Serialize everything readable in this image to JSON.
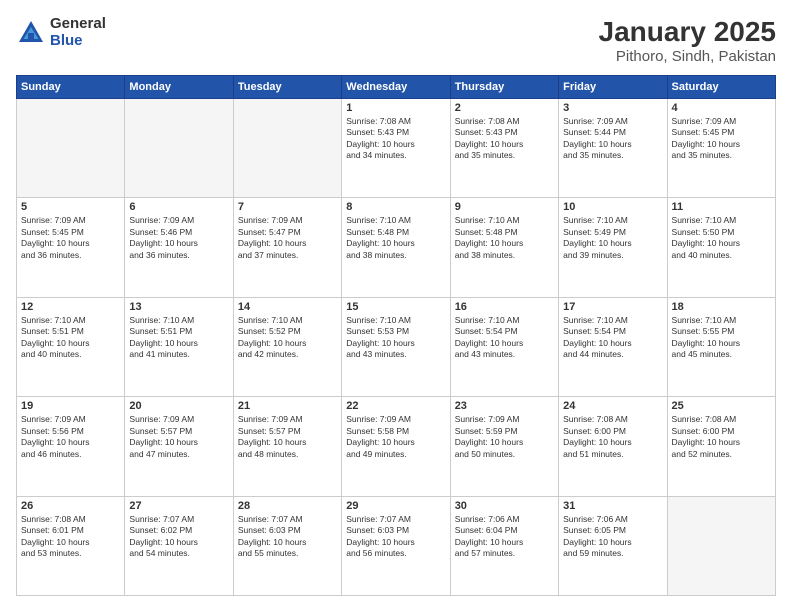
{
  "header": {
    "logo_general": "General",
    "logo_blue": "Blue",
    "title": "January 2025",
    "subtitle": "Pithoro, Sindh, Pakistan"
  },
  "days_of_week": [
    "Sunday",
    "Monday",
    "Tuesday",
    "Wednesday",
    "Thursday",
    "Friday",
    "Saturday"
  ],
  "weeks": [
    [
      {
        "day": "",
        "info": ""
      },
      {
        "day": "",
        "info": ""
      },
      {
        "day": "",
        "info": ""
      },
      {
        "day": "1",
        "info": "Sunrise: 7:08 AM\nSunset: 5:43 PM\nDaylight: 10 hours\nand 34 minutes."
      },
      {
        "day": "2",
        "info": "Sunrise: 7:08 AM\nSunset: 5:43 PM\nDaylight: 10 hours\nand 35 minutes."
      },
      {
        "day": "3",
        "info": "Sunrise: 7:09 AM\nSunset: 5:44 PM\nDaylight: 10 hours\nand 35 minutes."
      },
      {
        "day": "4",
        "info": "Sunrise: 7:09 AM\nSunset: 5:45 PM\nDaylight: 10 hours\nand 35 minutes."
      }
    ],
    [
      {
        "day": "5",
        "info": "Sunrise: 7:09 AM\nSunset: 5:45 PM\nDaylight: 10 hours\nand 36 minutes."
      },
      {
        "day": "6",
        "info": "Sunrise: 7:09 AM\nSunset: 5:46 PM\nDaylight: 10 hours\nand 36 minutes."
      },
      {
        "day": "7",
        "info": "Sunrise: 7:09 AM\nSunset: 5:47 PM\nDaylight: 10 hours\nand 37 minutes."
      },
      {
        "day": "8",
        "info": "Sunrise: 7:10 AM\nSunset: 5:48 PM\nDaylight: 10 hours\nand 38 minutes."
      },
      {
        "day": "9",
        "info": "Sunrise: 7:10 AM\nSunset: 5:48 PM\nDaylight: 10 hours\nand 38 minutes."
      },
      {
        "day": "10",
        "info": "Sunrise: 7:10 AM\nSunset: 5:49 PM\nDaylight: 10 hours\nand 39 minutes."
      },
      {
        "day": "11",
        "info": "Sunrise: 7:10 AM\nSunset: 5:50 PM\nDaylight: 10 hours\nand 40 minutes."
      }
    ],
    [
      {
        "day": "12",
        "info": "Sunrise: 7:10 AM\nSunset: 5:51 PM\nDaylight: 10 hours\nand 40 minutes."
      },
      {
        "day": "13",
        "info": "Sunrise: 7:10 AM\nSunset: 5:51 PM\nDaylight: 10 hours\nand 41 minutes."
      },
      {
        "day": "14",
        "info": "Sunrise: 7:10 AM\nSunset: 5:52 PM\nDaylight: 10 hours\nand 42 minutes."
      },
      {
        "day": "15",
        "info": "Sunrise: 7:10 AM\nSunset: 5:53 PM\nDaylight: 10 hours\nand 43 minutes."
      },
      {
        "day": "16",
        "info": "Sunrise: 7:10 AM\nSunset: 5:54 PM\nDaylight: 10 hours\nand 43 minutes."
      },
      {
        "day": "17",
        "info": "Sunrise: 7:10 AM\nSunset: 5:54 PM\nDaylight: 10 hours\nand 44 minutes."
      },
      {
        "day": "18",
        "info": "Sunrise: 7:10 AM\nSunset: 5:55 PM\nDaylight: 10 hours\nand 45 minutes."
      }
    ],
    [
      {
        "day": "19",
        "info": "Sunrise: 7:09 AM\nSunset: 5:56 PM\nDaylight: 10 hours\nand 46 minutes."
      },
      {
        "day": "20",
        "info": "Sunrise: 7:09 AM\nSunset: 5:57 PM\nDaylight: 10 hours\nand 47 minutes."
      },
      {
        "day": "21",
        "info": "Sunrise: 7:09 AM\nSunset: 5:57 PM\nDaylight: 10 hours\nand 48 minutes."
      },
      {
        "day": "22",
        "info": "Sunrise: 7:09 AM\nSunset: 5:58 PM\nDaylight: 10 hours\nand 49 minutes."
      },
      {
        "day": "23",
        "info": "Sunrise: 7:09 AM\nSunset: 5:59 PM\nDaylight: 10 hours\nand 50 minutes."
      },
      {
        "day": "24",
        "info": "Sunrise: 7:08 AM\nSunset: 6:00 PM\nDaylight: 10 hours\nand 51 minutes."
      },
      {
        "day": "25",
        "info": "Sunrise: 7:08 AM\nSunset: 6:00 PM\nDaylight: 10 hours\nand 52 minutes."
      }
    ],
    [
      {
        "day": "26",
        "info": "Sunrise: 7:08 AM\nSunset: 6:01 PM\nDaylight: 10 hours\nand 53 minutes."
      },
      {
        "day": "27",
        "info": "Sunrise: 7:07 AM\nSunset: 6:02 PM\nDaylight: 10 hours\nand 54 minutes."
      },
      {
        "day": "28",
        "info": "Sunrise: 7:07 AM\nSunset: 6:03 PM\nDaylight: 10 hours\nand 55 minutes."
      },
      {
        "day": "29",
        "info": "Sunrise: 7:07 AM\nSunset: 6:03 PM\nDaylight: 10 hours\nand 56 minutes."
      },
      {
        "day": "30",
        "info": "Sunrise: 7:06 AM\nSunset: 6:04 PM\nDaylight: 10 hours\nand 57 minutes."
      },
      {
        "day": "31",
        "info": "Sunrise: 7:06 AM\nSunset: 6:05 PM\nDaylight: 10 hours\nand 59 minutes."
      },
      {
        "day": "",
        "info": ""
      }
    ]
  ]
}
